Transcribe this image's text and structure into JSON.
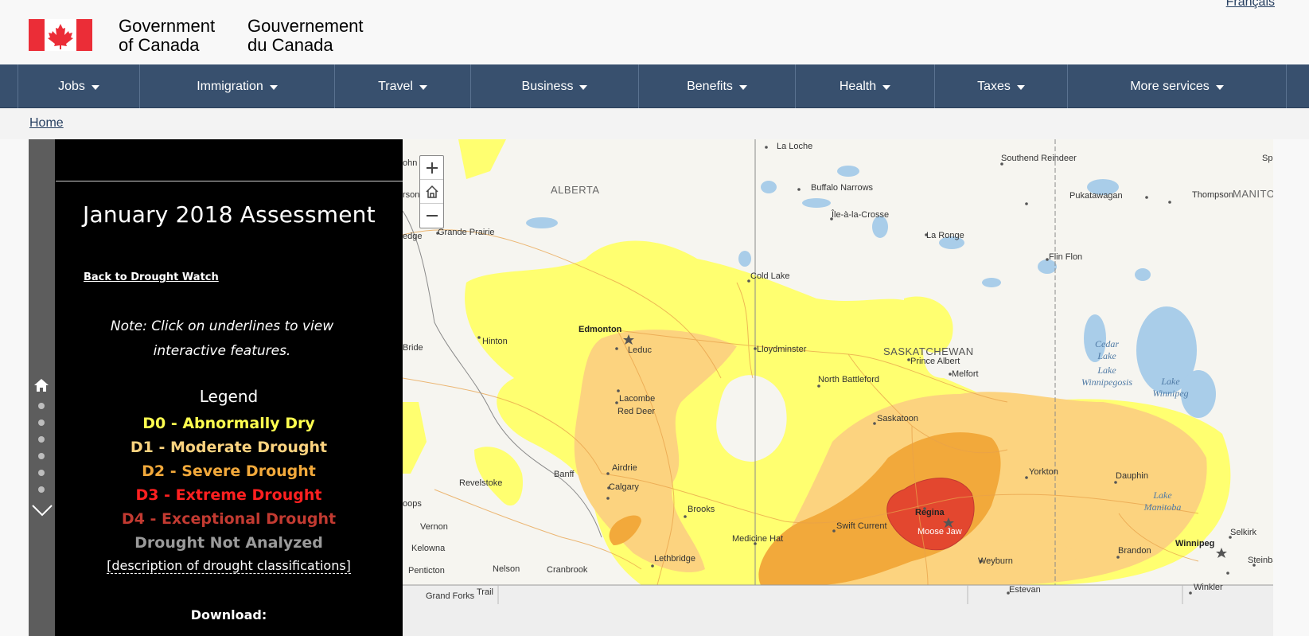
{
  "header": {
    "signature_en_line1": "Government",
    "signature_en_line2": "of Canada",
    "signature_fr_line1": "Gouvernement",
    "signature_fr_line2": "du Canada",
    "language_link": "Français"
  },
  "nav": {
    "items": [
      {
        "label": "Jobs"
      },
      {
        "label": "Immigration"
      },
      {
        "label": "Travel"
      },
      {
        "label": "Business"
      },
      {
        "label": "Benefits"
      },
      {
        "label": "Health"
      },
      {
        "label": "Taxes"
      },
      {
        "label": "More services"
      }
    ]
  },
  "breadcrumb": {
    "home": "Home"
  },
  "panel": {
    "title": "January 2018 Assessment",
    "back_link": "Back to Drought Watch",
    "note": "Note: Click on underlines to view interactive features.",
    "legend_title": "Legend",
    "legend": [
      {
        "label": "D0 - Abnormally Dry",
        "color": "#ffff4f"
      },
      {
        "label": "D1 - Moderate Drought",
        "color": "#fcd37f"
      },
      {
        "label": "D2 - Severe Drought",
        "color": "#f2a93b"
      },
      {
        "label": "D3 - Extreme Drought",
        "color": "#ff2020"
      },
      {
        "label": "D4 - Exceptional Drought",
        "color": "#c23a31"
      },
      {
        "label": "Drought Not Analyzed",
        "color": "#9a9a9a"
      }
    ],
    "description_link": "[description of drought classifications]",
    "download_label": "Download:"
  },
  "map": {
    "zoom_in": "+",
    "zoom_out": "−",
    "provinces": {
      "alberta": "ALBERTA",
      "saskatchewan": "SASKATCHEWAN",
      "manitoba": "MANITO"
    },
    "places": {
      "la_loche": "La Loche",
      "southend": "Southend Reindeer",
      "spl": "Spl",
      "buffalo": "Buffalo Narrows",
      "ile": "Île-à-la-Crosse",
      "pukatawagan": "Pukatawagan",
      "thompson": "Thompson",
      "la_ronge": "La Ronge",
      "flin_flon": "Flin Flon",
      "grande_prairie": "Grande Prairie",
      "cold_lake": "Cold Lake",
      "edmonton": "Edmonton",
      "hinton": "Hinton",
      "leduc": "Leduc",
      "lloydminster": "Lloydminster",
      "prince_albert": "Prince Albert",
      "melfort": "Melfort",
      "north_battleford": "North Battleford",
      "lacombe": "Lacombe",
      "red_deer": "Red Deer",
      "saskatoon": "Saskatoon",
      "airdrie": "Airdrie",
      "calgary": "Calgary",
      "banff": "Banff",
      "revelstoke": "Revelstoke",
      "brooks": "Brooks",
      "yorkton": "Yorkton",
      "dauphin": "Dauphin",
      "regina": "Regina",
      "moose_jaw": "Moose Jaw",
      "swift_current": "Swift Current",
      "medicine_hat": "Medicine Hat",
      "lethbridge": "Lethbridge",
      "weyburn": "Weyburn",
      "brandon": "Brandon",
      "winnipeg": "Winnipeg",
      "selkirk": "Selkirk",
      "steinbach": "Steinbac",
      "vernon": "Vernon",
      "kelowna": "Kelowna",
      "penticton": "Penticton",
      "nelson": "Nelson",
      "cranbrook": "Cranbrook",
      "grand_forks": "Grand Forks",
      "trail": "Trail",
      "estevan": "Estevan",
      "winkler": "Winkler",
      "bride": "Bride",
      "loops": "oops",
      "john": "ohn",
      "rson": "rson",
      "edge": "edge"
    },
    "water": {
      "cedar": "Cedar Lake",
      "winnipegosis": "Lake Winnipegosis",
      "lake_winnipeg": "Lake Winnipeg",
      "manitoba": "Lake Manitoba"
    }
  }
}
